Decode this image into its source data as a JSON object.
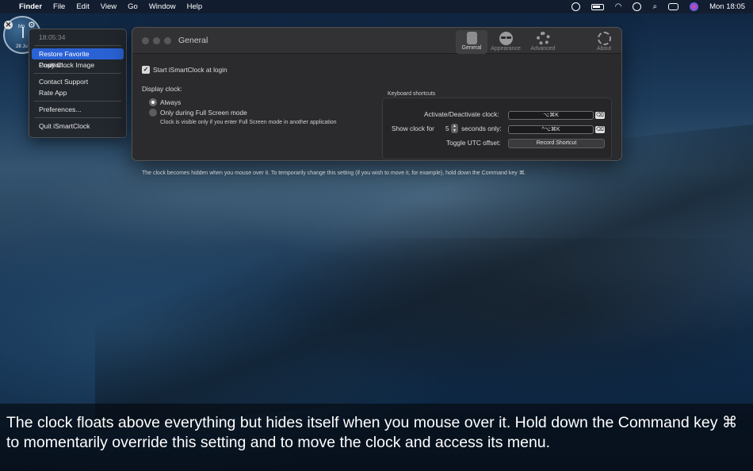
{
  "menubar": {
    "app_name": "Finder",
    "menus": [
      "File",
      "Edit",
      "View",
      "Go",
      "Window",
      "Help"
    ],
    "clock": "Mon 18:05",
    "icons": [
      "apple-icon",
      "target-icon",
      "battery-icon",
      "wifi-icon",
      "user-icon",
      "search-icon",
      "control-center-icon",
      "siri-icon"
    ]
  },
  "clock_widget": {
    "day_label": "Mo",
    "date_label": "28 Ju",
    "close_symbol": "✕",
    "gear_symbol": "⚙"
  },
  "context_menu": {
    "time": "18:05:34",
    "items": [
      {
        "label": "Restore Favorite Position..."
      },
      {
        "label": "Copy Clock Image"
      },
      {
        "label": "Contact Support"
      },
      {
        "label": "Rate App"
      },
      {
        "label": "Preferences..."
      },
      {
        "label": "Quit iSmartClock"
      }
    ]
  },
  "prefs": {
    "title": "General",
    "tabs": [
      {
        "label": "General"
      },
      {
        "label": "Appearance"
      },
      {
        "label": "Advanced"
      },
      {
        "label": "About"
      }
    ],
    "start_at_login": {
      "label": "Start iSmartClock at login",
      "checked": true
    },
    "display_clock_label": "Display clock:",
    "options": [
      {
        "label": "Always",
        "selected": true
      },
      {
        "label": "Only during Full Screen mode",
        "selected": false
      }
    ],
    "fullscreen_note": "Clock is visible only if you enter Full Screen mode in another application",
    "keyboard_shortcuts": {
      "title": "Keyboard shortcuts",
      "activate_label": "Activate/Deactivate clock:",
      "activate_shortcut": "⌥⌘K",
      "show_label": "Show clock for",
      "show_seconds": "5",
      "show_suffix": "seconds only:",
      "show_shortcut": "^⌥⌘K",
      "utc_label": "Toggle UTC offset:",
      "utc_button": "Record Shortcut",
      "clear_symbol": "⌫"
    },
    "footer_note": "The clock becomes hidden when you mouse over it. To temporarily change this setting (if you wish to move it, for example), hold down the Command key ⌘."
  },
  "caption": {
    "line1": "The clock floats above everything but hides itself when you mouse over it. Hold down the Command key ⌘",
    "line2": "to momentarily override this setting and to move the clock and access its menu."
  }
}
